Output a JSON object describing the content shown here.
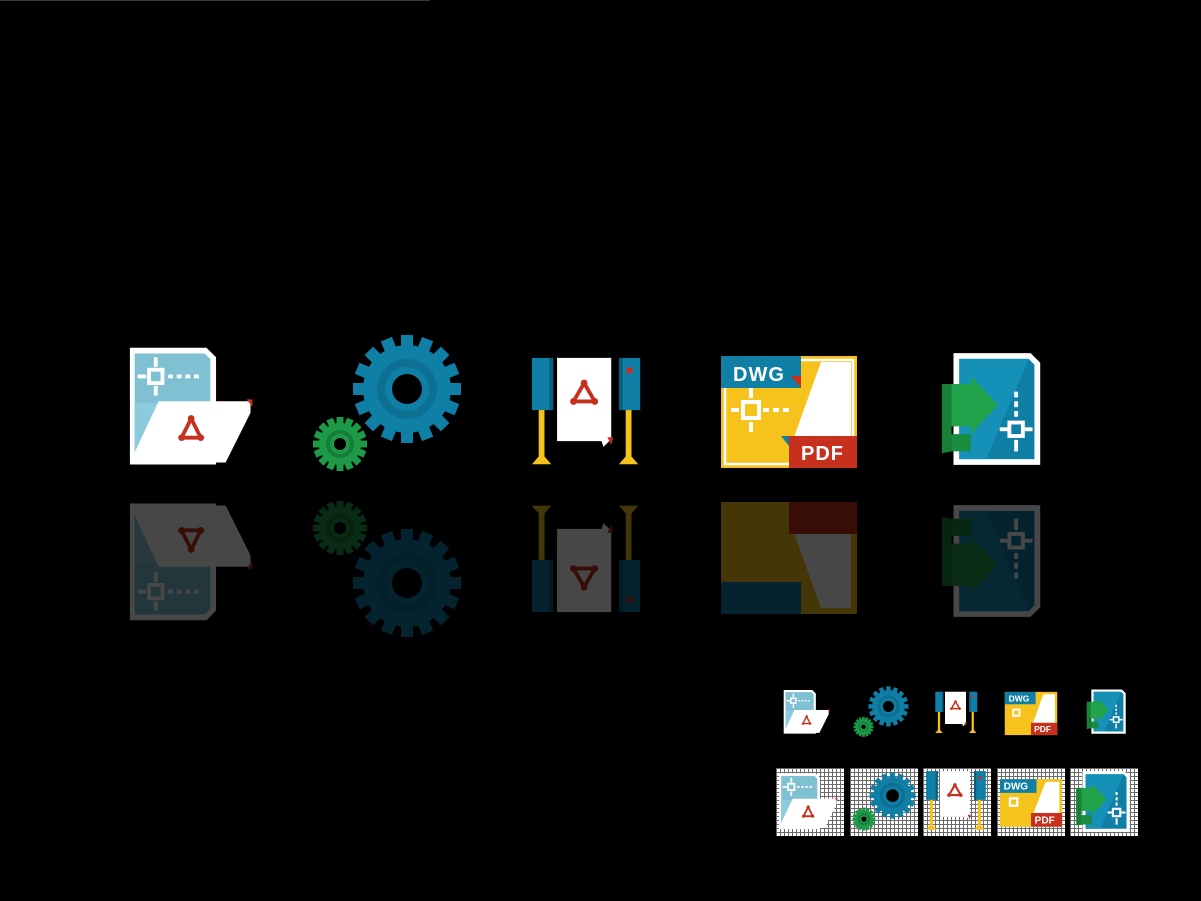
{
  "colors": {
    "background": "#000000",
    "blueprint_teal": "#0f7fa6",
    "light_teal": "#7fc0d3",
    "acrobat_red": "#c8301e",
    "yellow": "#f6c21c",
    "gear_green": "#1d9a47",
    "arrow_green": "#22a24a",
    "white": "#ffffff"
  },
  "icons": [
    {
      "name": "dwg-to-pdf-document-icon"
    },
    {
      "name": "settings-gears-icon"
    },
    {
      "name": "plotter-printer-icon"
    },
    {
      "name": "dwg-pdf-badge-icon",
      "top_label": "DWG",
      "bottom_label": "PDF"
    },
    {
      "name": "import-arrow-document-icon"
    }
  ],
  "badge": {
    "dwg_label": "DWG",
    "pdf_label": "PDF"
  }
}
